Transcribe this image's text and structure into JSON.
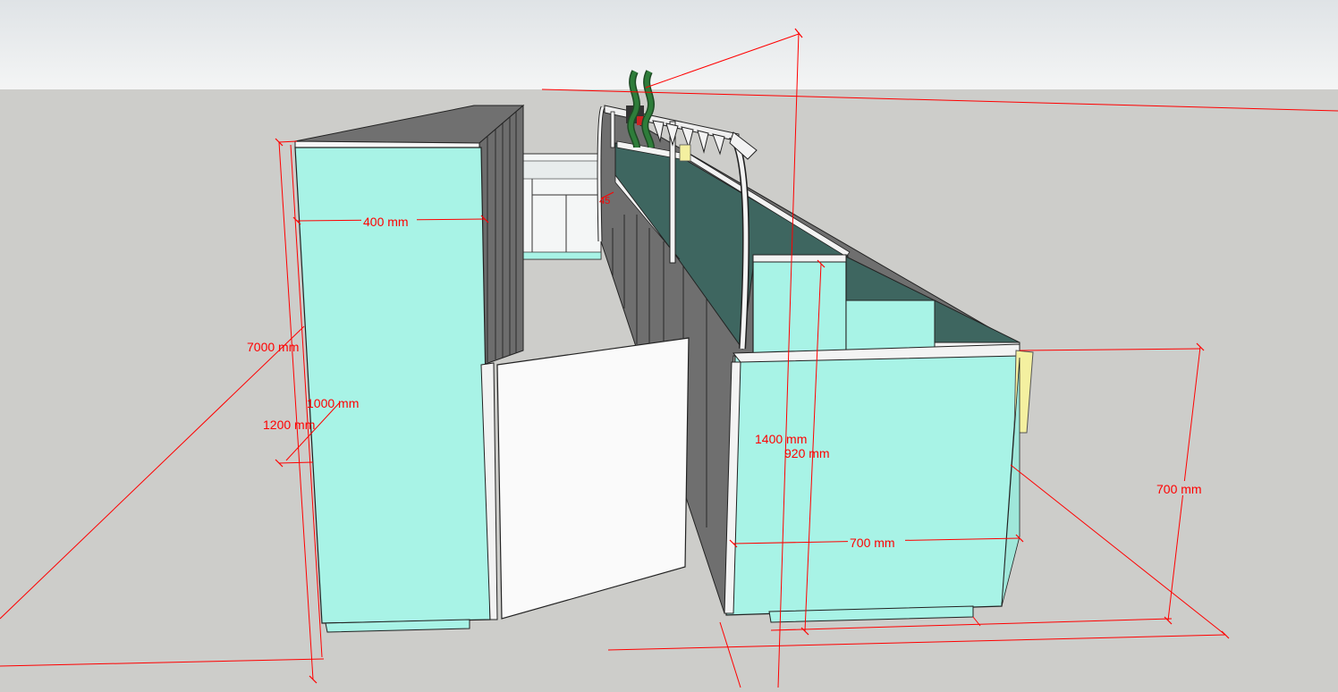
{
  "colors": {
    "sky_top": "#dfe3e6",
    "sky_bottom": "#f3f4f4",
    "ground": "#cdcdca",
    "panel": "#a8f3e6",
    "dark_side": "#707070",
    "trough": "#3f6660",
    "dimension": "#ff0000",
    "hook": "#2e7d3a",
    "accent_yellow": "#f4f0a0"
  },
  "dimensions": {
    "width_400": "400 mm",
    "length_7000": "7000 mm",
    "h_1000": "1000 mm",
    "h_1200": "1200 mm",
    "h_1400": "1400 mm",
    "h_920": "920 mm",
    "w_700": "700 mm",
    "h_700": "700 mm",
    "small_mark": "45"
  }
}
